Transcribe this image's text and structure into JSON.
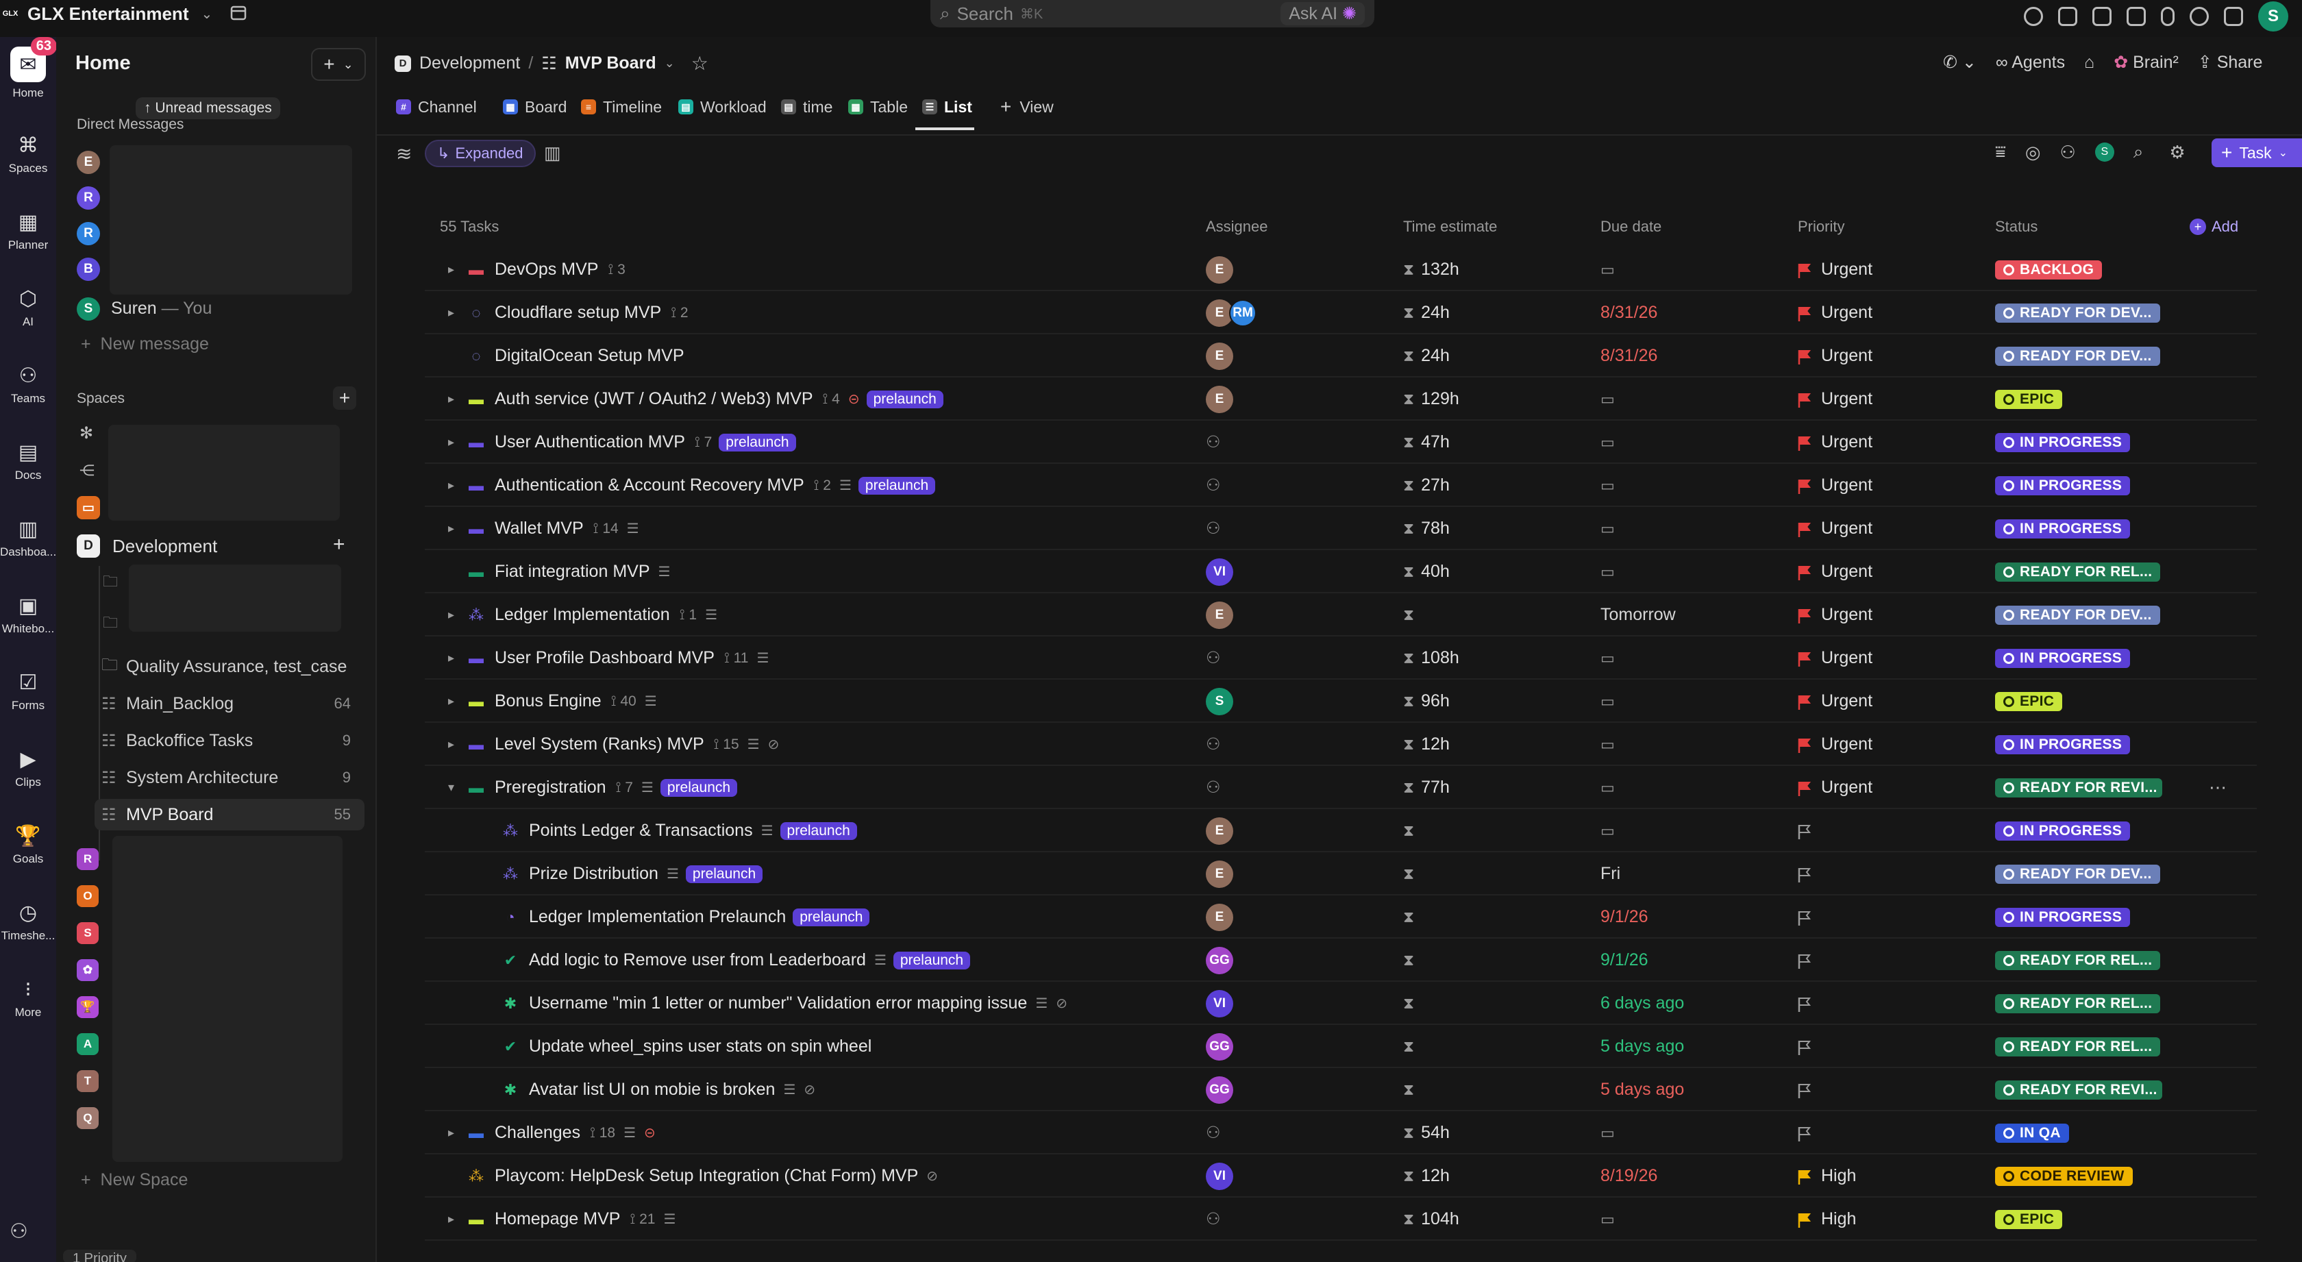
{
  "topbar": {
    "workspace_name": "GLX Entertainment",
    "logo_text": "GLX",
    "search_placeholder": "Search",
    "search_shortcut": "⌘K",
    "ask_ai_label": "Ask AI",
    "user_initial": "S"
  },
  "rail": {
    "home_label": "Home",
    "notification_count": "63",
    "items": [
      {
        "label": "Spaces",
        "icon": "spaces-icon"
      },
      {
        "label": "Planner",
        "icon": "planner-icon"
      },
      {
        "label": "AI",
        "icon": "ai-icon"
      },
      {
        "label": "Teams",
        "icon": "teams-icon"
      },
      {
        "label": "Docs",
        "icon": "docs-icon"
      },
      {
        "label": "Dashboa...",
        "icon": "dashboards-icon"
      },
      {
        "label": "Whitebo...",
        "icon": "whiteboards-icon"
      },
      {
        "label": "Forms",
        "icon": "forms-icon"
      },
      {
        "label": "Clips",
        "icon": "clips-icon"
      },
      {
        "label": "Goals",
        "icon": "goals-icon"
      },
      {
        "label": "Timeshe...",
        "icon": "timesheets-icon"
      },
      {
        "label": "More",
        "icon": "more-icon"
      }
    ]
  },
  "sidebar": {
    "title": "Home",
    "unread_tooltip": "Unread messages",
    "direct_messages_heading": "Direct Messages",
    "dm_avatars": [
      {
        "initial": "E",
        "color": "#8f6d5c"
      },
      {
        "initial": "R",
        "color": "#6a4fe0"
      },
      {
        "initial": "R",
        "color": "#2f84e0"
      },
      {
        "initial": "B",
        "color": "#5a49d6"
      }
    ],
    "self_user": {
      "initial": "S",
      "name": "Suren",
      "suffix": "— You"
    },
    "new_message_label": "New message",
    "spaces_heading": "Spaces",
    "development_space": {
      "initial": "D",
      "name": "Development"
    },
    "folders": [
      {
        "label": "Quality Assurance, test_case",
        "count": ""
      },
      {
        "label": "Main_Backlog",
        "count": "64"
      },
      {
        "label": "Backoffice Tasks",
        "count": "9"
      },
      {
        "label": "System Architecture",
        "count": "9"
      },
      {
        "label": "MVP Board",
        "count": "55"
      }
    ],
    "other_spaces": [
      {
        "initial": "R",
        "color": "#a245c8"
      },
      {
        "initial": "O",
        "color": "#e06a1d"
      },
      {
        "initial": "S",
        "color": "#e04a5a"
      },
      {
        "initial": "✿",
        "color": "#9b4ed8"
      },
      {
        "initial": "🏆",
        "color": "#b04ad8"
      },
      {
        "initial": "A",
        "color": "#1a9c6b"
      },
      {
        "initial": "T",
        "color": "#9a6a5e"
      },
      {
        "initial": "Q",
        "color": "#a07a70"
      }
    ],
    "new_space_label": "New Space",
    "bottom_pill": "1 Priority"
  },
  "header": {
    "breadcrumb_space_initial": "D",
    "breadcrumb_space": "Development",
    "breadcrumb_sep": "/",
    "breadcrumb_list": "MVP Board",
    "agents_label": "Agents",
    "brain_label": "Brain²",
    "share_label": "Share"
  },
  "views": {
    "tabs": [
      {
        "label": "Channel",
        "icon": "#",
        "color": "#6a4fe0"
      },
      {
        "label": "Board",
        "icon": "▦",
        "color": "#3c6be0"
      },
      {
        "label": "Timeline",
        "icon": "≡",
        "color": "#e06a1d"
      },
      {
        "label": "Workload",
        "icon": "▤",
        "color": "#1ab0a0"
      },
      {
        "label": "time",
        "icon": "▤",
        "color": "#555555"
      },
      {
        "label": "Table",
        "icon": "▦",
        "color": "#2e9c5e"
      },
      {
        "label": "List",
        "icon": "☰",
        "color": "#555555"
      }
    ],
    "add_view_label": "View"
  },
  "toolbar": {
    "expanded_label": "Expanded",
    "task_button_label": "Task",
    "user_initial": "S"
  },
  "table": {
    "count_label": "55 Tasks",
    "columns": {
      "assignee": "Assignee",
      "time_estimate": "Time estimate",
      "due_date": "Due date",
      "priority": "Priority",
      "status": "Status",
      "add": "Add"
    },
    "rows": [
      {
        "name": "DevOps MVP",
        "level": 0,
        "caret": "▸",
        "type_icon": "▬",
        "type_color": "#e04a5a",
        "subtasks": "3",
        "lines": false,
        "pill": "",
        "extra": "",
        "assignees": [
          {
            "i": "E",
            "c": "#8f6d5c"
          }
        ],
        "estimate": "132h",
        "due": "",
        "due_color": "",
        "priority": "Urgent",
        "priority_color": "#e43d3d",
        "status": "BACKLOG",
        "status_bg": "#e8505b",
        "status_fg": "#ffffff"
      },
      {
        "name": "Cloudflare setup MVP",
        "level": 0,
        "caret": "▸",
        "type_icon": "◌",
        "type_color": "#8a8ae0",
        "subtasks": "2",
        "lines": false,
        "pill": "",
        "extra": "",
        "assignees": [
          {
            "i": "E",
            "c": "#8f6d5c"
          },
          {
            "i": "RM",
            "c": "#2f84e0"
          }
        ],
        "estimate": "24h",
        "due": "8/31/26",
        "due_color": "#e8605b",
        "priority": "Urgent",
        "priority_color": "#e43d3d",
        "status": "READY FOR DEV...",
        "status_bg": "#6b7fb8",
        "status_fg": "#ffffff"
      },
      {
        "name": "DigitalOcean Setup MVP",
        "level": 0,
        "caret": "",
        "type_icon": "◌",
        "type_color": "#8a8ae0",
        "subtasks": "",
        "lines": false,
        "pill": "",
        "extra": "",
        "assignees": [
          {
            "i": "E",
            "c": "#8f6d5c"
          }
        ],
        "estimate": "24h",
        "due": "8/31/26",
        "due_color": "#e8605b",
        "priority": "Urgent",
        "priority_color": "#e43d3d",
        "status": "READY FOR DEV...",
        "status_bg": "#6b7fb8",
        "status_fg": "#ffffff"
      },
      {
        "name": "Auth service (JWT / OAuth2 / Web3) MVP",
        "level": 0,
        "caret": "▸",
        "type_icon": "▬",
        "type_color": "#c8e63a",
        "subtasks": "4",
        "lines": false,
        "pill": "prelaunch",
        "extra": "⊝",
        "assignees": [
          {
            "i": "E",
            "c": "#8f6d5c"
          }
        ],
        "estimate": "129h",
        "due": "",
        "due_color": "",
        "priority": "Urgent",
        "priority_color": "#e43d3d",
        "status": "EPIC",
        "status_bg": "#c8e63a",
        "status_fg": "#1d2a05"
      },
      {
        "name": "User Authentication MVP",
        "level": 0,
        "caret": "▸",
        "type_icon": "▬",
        "type_color": "#6a4fe0",
        "subtasks": "7",
        "lines": false,
        "pill": "prelaunch",
        "extra": "",
        "assignees": [],
        "estimate": "47h",
        "due": "",
        "due_color": "",
        "priority": "Urgent",
        "priority_color": "#e43d3d",
        "status": "IN PROGRESS",
        "status_bg": "#5a3fd6",
        "status_fg": "#ffffff"
      },
      {
        "name": "Authentication & Account Recovery MVP",
        "level": 0,
        "caret": "▸",
        "type_icon": "▬",
        "type_color": "#6a4fe0",
        "subtasks": "2",
        "lines": true,
        "pill": "prelaunch",
        "extra": "",
        "assignees": [],
        "estimate": "27h",
        "due": "",
        "due_color": "",
        "priority": "Urgent",
        "priority_color": "#e43d3d",
        "status": "IN PROGRESS",
        "status_bg": "#5a3fd6",
        "status_fg": "#ffffff"
      },
      {
        "name": "Wallet MVP",
        "level": 0,
        "caret": "▸",
        "type_icon": "▬",
        "type_color": "#6a4fe0",
        "subtasks": "14",
        "lines": true,
        "pill": "",
        "extra": "",
        "assignees": [],
        "estimate": "78h",
        "due": "",
        "due_color": "",
        "priority": "Urgent",
        "priority_color": "#e43d3d",
        "status": "IN PROGRESS",
        "status_bg": "#5a3fd6",
        "status_fg": "#ffffff"
      },
      {
        "name": "Fiat integration MVP",
        "level": 0,
        "caret": "",
        "type_icon": "▬",
        "type_color": "#1a9c6b",
        "subtasks": "",
        "lines": true,
        "pill": "",
        "extra": "",
        "assignees": [
          {
            "i": "VI",
            "c": "#5a3fd6"
          }
        ],
        "estimate": "40h",
        "due": "",
        "due_color": "",
        "priority": "Urgent",
        "priority_color": "#e43d3d",
        "status": "READY FOR REL...",
        "status_bg": "#1f7a52",
        "status_fg": "#ffffff"
      },
      {
        "name": "Ledger Implementation",
        "level": 0,
        "caret": "▸",
        "type_icon": "⁂",
        "type_color": "#7a6ae8",
        "subtasks": "1",
        "lines": true,
        "pill": "",
        "extra": "",
        "assignees": [
          {
            "i": "E",
            "c": "#8f6d5c"
          }
        ],
        "estimate": "",
        "due": "Tomorrow",
        "due_color": "#d6d6d6",
        "priority": "Urgent",
        "priority_color": "#e43d3d",
        "status": "READY FOR DEV...",
        "status_bg": "#6b7fb8",
        "status_fg": "#ffffff"
      },
      {
        "name": "User Profile Dashboard MVP",
        "level": 0,
        "caret": "▸",
        "type_icon": "▬",
        "type_color": "#6a4fe0",
        "subtasks": "11",
        "lines": true,
        "pill": "",
        "extra": "",
        "assignees": [],
        "estimate": "108h",
        "due": "",
        "due_color": "",
        "priority": "Urgent",
        "priority_color": "#e43d3d",
        "status": "IN PROGRESS",
        "status_bg": "#5a3fd6",
        "status_fg": "#ffffff"
      },
      {
        "name": "Bonus Engine",
        "level": 0,
        "caret": "▸",
        "type_icon": "▬",
        "type_color": "#c8e63a",
        "subtasks": "40",
        "lines": true,
        "pill": "",
        "extra": "",
        "assignees": [
          {
            "i": "S",
            "c": "#14916b"
          }
        ],
        "estimate": "96h",
        "due": "",
        "due_color": "",
        "priority": "Urgent",
        "priority_color": "#e43d3d",
        "status": "EPIC",
        "status_bg": "#c8e63a",
        "status_fg": "#1d2a05"
      },
      {
        "name": "Level System (Ranks) MVP",
        "level": 0,
        "caret": "▸",
        "type_icon": "▬",
        "type_color": "#6a4fe0",
        "subtasks": "15",
        "lines": true,
        "pill": "",
        "extra": "⊘",
        "assignees": [],
        "estimate": "12h",
        "due": "",
        "due_color": "",
        "priority": "Urgent",
        "priority_color": "#e43d3d",
        "status": "IN PROGRESS",
        "status_bg": "#5a3fd6",
        "status_fg": "#ffffff"
      },
      {
        "name": "Preregistration",
        "level": 0,
        "caret": "▾",
        "type_icon": "▬",
        "type_color": "#1a9c6b",
        "subtasks": "7",
        "lines": true,
        "pill": "prelaunch",
        "extra": "",
        "assignees": [],
        "estimate": "77h",
        "due": "",
        "due_color": "",
        "priority": "Urgent",
        "priority_color": "#e43d3d",
        "status": "READY FOR REVI...",
        "status_bg": "#1f7a52",
        "status_fg": "#ffffff"
      },
      {
        "name": "Points Ledger & Transactions",
        "level": 1,
        "caret": "",
        "type_icon": "⁂",
        "type_color": "#7a6ae8",
        "subtasks": "",
        "lines": true,
        "pill": "prelaunch",
        "extra": "",
        "assignees": [
          {
            "i": "E",
            "c": "#8f6d5c"
          }
        ],
        "estimate": "",
        "due": "",
        "due_color": "",
        "priority": "",
        "priority_color": "#9a9a9a",
        "status": "IN PROGRESS",
        "status_bg": "#5a3fd6",
        "status_fg": "#ffffff"
      },
      {
        "name": "Prize Distribution",
        "level": 1,
        "caret": "",
        "type_icon": "⁂",
        "type_color": "#7a6ae8",
        "subtasks": "",
        "lines": true,
        "pill": "prelaunch",
        "extra": "",
        "assignees": [
          {
            "i": "E",
            "c": "#8f6d5c"
          }
        ],
        "estimate": "",
        "due": "Fri",
        "due_color": "#d6d6d6",
        "priority": "",
        "priority_color": "#9a9a9a",
        "status": "READY FOR DEV...",
        "status_bg": "#6b7fb8",
        "status_fg": "#ffffff"
      },
      {
        "name": "Ledger Implementation Prelaunch",
        "level": 1,
        "caret": "",
        "type_icon": "◔",
        "type_color": "#8a6ae8",
        "subtasks": "",
        "lines": false,
        "pill": "prelaunch",
        "extra": "",
        "assignees": [
          {
            "i": "E",
            "c": "#8f6d5c"
          }
        ],
        "estimate": "",
        "due": "9/1/26",
        "due_color": "#e8605b",
        "priority": "",
        "priority_color": "#9a9a9a",
        "status": "IN PROGRESS",
        "status_bg": "#5a3fd6",
        "status_fg": "#ffffff"
      },
      {
        "name": "Add logic to Remove user from Leaderboard",
        "level": 1,
        "caret": "",
        "type_icon": "✔",
        "type_color": "#1fae7a",
        "subtasks": "",
        "lines": true,
        "pill": "prelaunch",
        "extra": "",
        "assignees": [
          {
            "i": "GG",
            "c": "#a245c8"
          }
        ],
        "estimate": "",
        "due": "9/1/26",
        "due_color": "#2ec27e",
        "priority": "",
        "priority_color": "#9a9a9a",
        "status": "READY FOR REL...",
        "status_bg": "#1f7a52",
        "status_fg": "#ffffff"
      },
      {
        "name": "Username \"min 1 letter or number\" Validation error mapping issue",
        "level": 1,
        "caret": "",
        "type_icon": "✱",
        "type_color": "#2ec27e",
        "subtasks": "",
        "lines": true,
        "pill": "",
        "extra": "⊘",
        "assignees": [
          {
            "i": "VI",
            "c": "#5a3fd6"
          }
        ],
        "estimate": "",
        "due": "6 days ago",
        "due_color": "#2ec27e",
        "priority": "",
        "priority_color": "#9a9a9a",
        "status": "READY FOR REL...",
        "status_bg": "#1f7a52",
        "status_fg": "#ffffff"
      },
      {
        "name": "Update wheel_spins user stats on spin wheel",
        "level": 1,
        "caret": "",
        "type_icon": "✔",
        "type_color": "#1fae7a",
        "subtasks": "",
        "lines": false,
        "pill": "",
        "extra": "",
        "assignees": [
          {
            "i": "GG",
            "c": "#a245c8"
          }
        ],
        "estimate": "",
        "due": "5 days ago",
        "due_color": "#2ec27e",
        "priority": "",
        "priority_color": "#9a9a9a",
        "status": "READY FOR REL...",
        "status_bg": "#1f7a52",
        "status_fg": "#ffffff"
      },
      {
        "name": "Avatar list UI on mobie is broken",
        "level": 1,
        "caret": "",
        "type_icon": "✱",
        "type_color": "#2ec27e",
        "subtasks": "",
        "lines": true,
        "pill": "",
        "extra": "⊘",
        "assignees": [
          {
            "i": "GG",
            "c": "#a245c8"
          }
        ],
        "estimate": "",
        "due": "5 days ago",
        "due_color": "#e8605b",
        "priority": "",
        "priority_color": "#9a9a9a",
        "status": "READY FOR REVI...",
        "status_bg": "#1f7a52",
        "status_fg": "#ffffff"
      },
      {
        "name": "Challenges",
        "level": 0,
        "caret": "▸",
        "type_icon": "▬",
        "type_color": "#3c6be0",
        "subtasks": "18",
        "lines": true,
        "pill": "",
        "extra": "⊝",
        "assignees": [],
        "estimate": "54h",
        "due": "",
        "due_color": "",
        "priority": "",
        "priority_color": "#9a9a9a",
        "status": "IN QA",
        "status_bg": "#2d55d6",
        "status_fg": "#ffffff"
      },
      {
        "name": "Playcom: HelpDesk Setup Integration (Chat Form) MVP",
        "level": 0,
        "caret": "",
        "type_icon": "⁂",
        "type_color": "#e0a81d",
        "subtasks": "",
        "lines": false,
        "pill": "",
        "extra": "⊘",
        "assignees": [
          {
            "i": "VI",
            "c": "#5a3fd6"
          }
        ],
        "estimate": "12h",
        "due": "8/19/26",
        "due_color": "#e8605b",
        "priority": "High",
        "priority_color": "#f0b400",
        "status": "CODE REVIEW",
        "status_bg": "#f0b400",
        "status_fg": "#2a1f00"
      },
      {
        "name": "Homepage MVP",
        "level": 0,
        "caret": "▸",
        "type_icon": "▬",
        "type_color": "#c8e63a",
        "subtasks": "21",
        "lines": true,
        "pill": "",
        "extra": "",
        "assignees": [],
        "estimate": "104h",
        "due": "",
        "due_color": "",
        "priority": "High",
        "priority_color": "#f0b400",
        "status": "EPIC",
        "status_bg": "#c8e63a",
        "status_fg": "#1d2a05"
      }
    ]
  }
}
